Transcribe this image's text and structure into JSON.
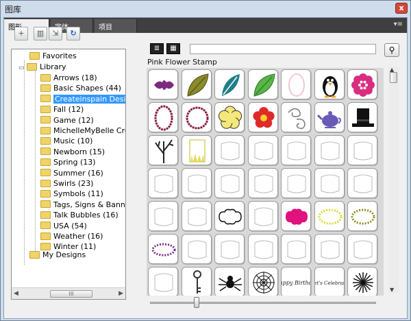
{
  "window": {
    "title": "图库",
    "close_label": "x"
  },
  "tabs": [
    {
      "label": "图形",
      "active": true
    },
    {
      "label": "字体",
      "active": false
    },
    {
      "label": "项目",
      "active": false
    }
  ],
  "tab_menu_label": "▾≡",
  "toolbar_icons": [
    "new-folder-icon",
    "delete-icon",
    "import-icon",
    "refresh-icon"
  ],
  "tree": {
    "root_nodes": [
      "Favorites",
      "Library",
      "My Designs"
    ],
    "library_children": [
      {
        "label": "Arrows (18)",
        "selected": false
      },
      {
        "label": "Basic Shapes (44)",
        "selected": false
      },
      {
        "label": "Createinspain Designs",
        "selected": true
      },
      {
        "label": "Fall (12)",
        "selected": false
      },
      {
        "label": "Game (12)",
        "selected": false
      },
      {
        "label": "MichelleMyBelle Creations",
        "selected": false
      },
      {
        "label": "Music (10)",
        "selected": false
      },
      {
        "label": "Newborn (15)",
        "selected": false
      },
      {
        "label": "Spring (13)",
        "selected": false
      },
      {
        "label": "Summer (16)",
        "selected": false
      },
      {
        "label": "Swirls (23)",
        "selected": false
      },
      {
        "label": "Symbols (11)",
        "selected": false
      },
      {
        "label": "Tags, Signs & Banners",
        "selected": false
      },
      {
        "label": "Talk Bubbles (16)",
        "selected": false
      },
      {
        "label": "USA (54)",
        "selected": false
      },
      {
        "label": "Weather (16)",
        "selected": false
      },
      {
        "label": "Winter (11)",
        "selected": false
      }
    ],
    "scroll_thumb_label": "III"
  },
  "view_buttons": [
    "list-view-icon",
    "grid-view-icon"
  ],
  "search": {
    "value": "",
    "placeholder": ""
  },
  "grid": {
    "hover_label": "Pink Flower Stamp",
    "rows": [
      [
        "purple-flourish",
        "olive-leaf",
        "teal-leaf",
        "green-leaf",
        "pink-oval-frame",
        "penguin",
        "pink-flower-stamp"
      ],
      [
        "scalloped-oval-frame",
        "scalloped-circle-frame",
        "yellow-flower",
        "red-flower",
        "swirl",
        "teapot",
        "top-hat"
      ],
      [
        "bare-tree",
        "yellow-grass-frame",
        "label-frame",
        "label-frame",
        "label-frame",
        "label-frame",
        "label-frame"
      ],
      [
        "label-frame",
        "label-frame",
        "label-frame",
        "label-frame",
        "label-frame",
        "label-frame",
        "label-frame"
      ],
      [
        "label-frame",
        "label-frame",
        "cloud-label",
        "label-frame",
        "magenta-splat",
        "yellow-dotted-oval",
        "olive-dotted-oval"
      ],
      [
        "purple-dotted-oval",
        "label-frame",
        "label-frame",
        "label-frame",
        "label-frame",
        "label-frame",
        "label-frame"
      ],
      [
        "label-frame",
        "key",
        "spider",
        "spider-web",
        "happy-birthday-text",
        "lets-celebrate-text",
        "starburst"
      ]
    ],
    "text_tiles": {
      "happy_birthday": "Happy Birthday",
      "lets_celebrate": "let's Celebrate"
    }
  },
  "colors": {
    "selection": "#3399ff",
    "tabstrip": "#3f3f3f",
    "accent_blue": "#1b5bd6"
  },
  "zoom_slider_level": 0.2
}
